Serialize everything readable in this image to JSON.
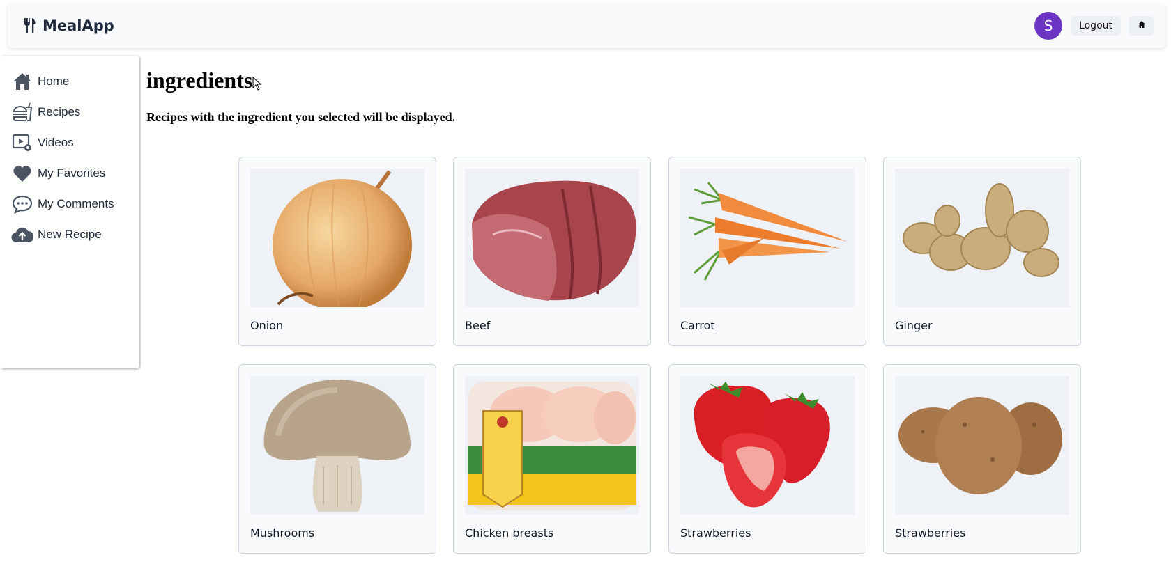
{
  "header": {
    "brand": "MealApp",
    "avatar_initial": "S",
    "logout_label": "Logout",
    "brand_icon": "fork-knife-icon",
    "home_icon": "home-icon"
  },
  "sidebar": {
    "items": [
      {
        "label": "Home",
        "icon": "home-icon"
      },
      {
        "label": "Recipes",
        "icon": "burger-icon"
      },
      {
        "label": "Videos",
        "icon": "video-settings-icon"
      },
      {
        "label": "My Favorites",
        "icon": "heart-icon"
      },
      {
        "label": "My Comments",
        "icon": "chat-bubble-icon"
      },
      {
        "label": "New Recipe",
        "icon": "cloud-upload-icon"
      }
    ]
  },
  "main": {
    "title": "ingredients",
    "subtitle": "Recipes with the ingredient you selected will be displayed.",
    "ingredients": [
      {
        "name": "Onion",
        "image": "onion-image"
      },
      {
        "name": "Beef",
        "image": "beef-image"
      },
      {
        "name": "Carrot",
        "image": "carrot-image"
      },
      {
        "name": "Ginger",
        "image": "ginger-image"
      },
      {
        "name": "Mushrooms",
        "image": "mushroom-image"
      },
      {
        "name": "Chicken breasts",
        "image": "chicken-breasts-image"
      },
      {
        "name": "Strawberries",
        "image": "strawberries-image"
      },
      {
        "name": "Strawberries",
        "image": "potatoes-image"
      }
    ]
  },
  "colors": {
    "avatar": "#6a35c2",
    "sidebar_icon": "#4b5563",
    "card_bg": "#f8fafc",
    "card_border": "#cbd5e1"
  }
}
